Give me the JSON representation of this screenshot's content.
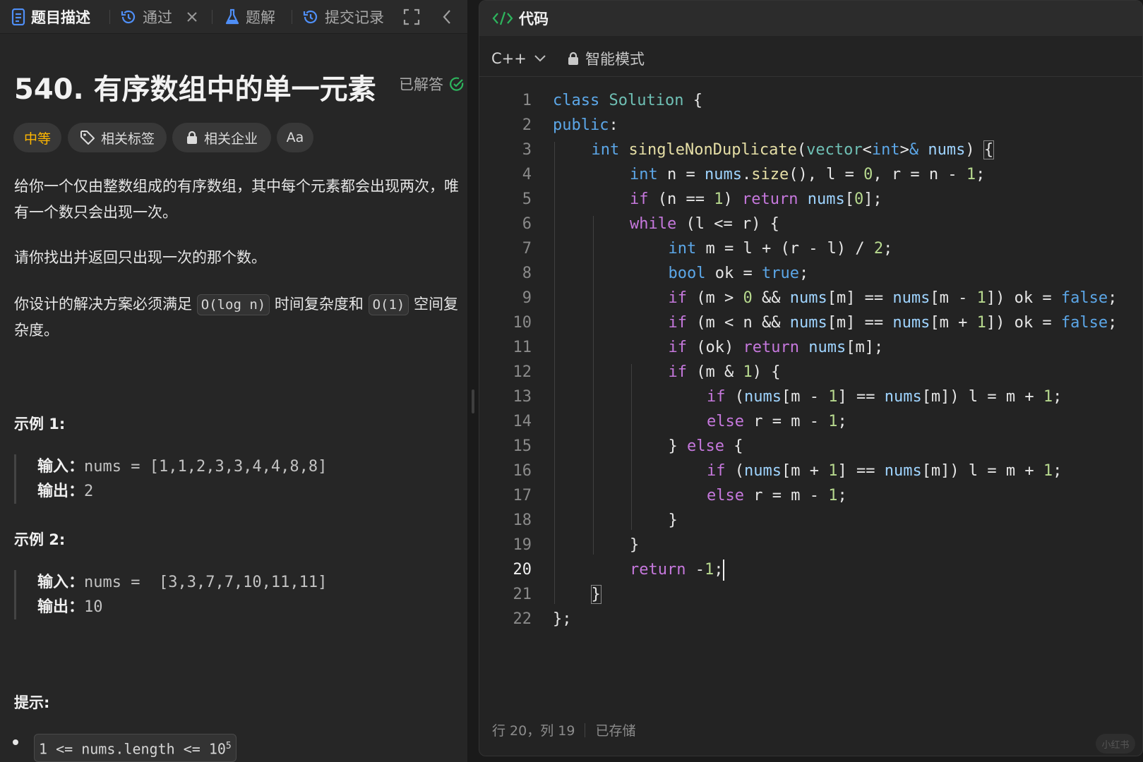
{
  "tabs": {
    "description": "题目描述",
    "result": "通过",
    "solutions": "题解",
    "submissions": "提交记录"
  },
  "problem": {
    "title": "540. 有序数组中的单一元素",
    "status": "已解答",
    "difficulty": "中等",
    "tags_label": "相关标签",
    "company_label": "相关企业",
    "font_label": "Aa",
    "desc_p1": "给你一个仅由整数组成的有序数组，其中每个元素都会出现两次，唯有一个数只会出现一次。",
    "desc_p2": "请你找出并返回只出现一次的那个数。",
    "desc_p3_a": "你设计的解决方案必须满足",
    "desc_p3_code1": "O(log n)",
    "desc_p3_b": "时间复杂度和",
    "desc_p3_code2": "O(1)",
    "desc_p3_c": "空间复杂度。",
    "examples": [
      {
        "title": "示例 1:",
        "input_label": "输入：",
        "input": "nums = [1,1,2,3,3,4,4,8,8]",
        "output_label": "输出：",
        "output": "2"
      },
      {
        "title": "示例 2:",
        "input_label": "输入：",
        "input": "nums =  [3,3,7,7,10,11,11]",
        "output_label": "输出：",
        "output": "10"
      }
    ],
    "hints_title": "提示:",
    "hint1_code": "1 <= nums.length <= 10",
    "hint1_sup": "5"
  },
  "code_panel": {
    "title": "代码",
    "language": "C++",
    "mode": "智能模式",
    "line_numbers": [
      "1",
      "2",
      "3",
      "4",
      "5",
      "6",
      "7",
      "8",
      "9",
      "10",
      "11",
      "12",
      "13",
      "14",
      "15",
      "16",
      "17",
      "18",
      "19",
      "20",
      "21",
      "22"
    ],
    "current_line": 20,
    "status_position": "行 20，列 19",
    "status_saved": "已存储"
  },
  "watermark": "小红书",
  "colors": {
    "difficulty_medium": "#ffb700",
    "accepted_green": "#2db55d",
    "code_keyword": "#5ca7e8",
    "code_control": "#c678dd",
    "code_type": "#6fc0b5",
    "code_number": "#b7d98e"
  },
  "icons": [
    "doc-icon",
    "history-icon",
    "close-icon",
    "flask-icon",
    "fullscreen-icon",
    "chevron-left-icon",
    "check-circle-icon",
    "tag-icon",
    "lock-icon",
    "code-icon",
    "chevron-down-icon"
  ]
}
